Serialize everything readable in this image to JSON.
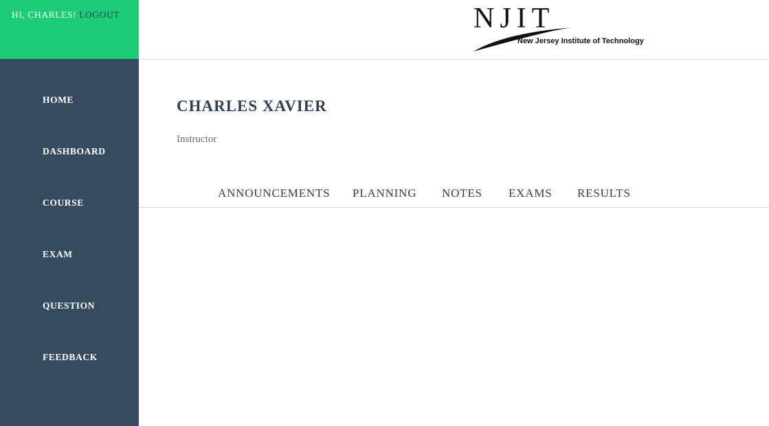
{
  "header": {
    "greeting": "HI, CHARLES!",
    "logout_label": "LOGOUT",
    "logo": {
      "wordmark": "NJIT",
      "tagline": "New Jersey Institute of Technology"
    }
  },
  "sidebar": {
    "items": [
      {
        "label": "HOME"
      },
      {
        "label": "DASHBOARD"
      },
      {
        "label": "COURSE"
      },
      {
        "label": "EXAM"
      },
      {
        "label": "QUESTION"
      },
      {
        "label": "FEEDBACK"
      }
    ]
  },
  "profile": {
    "name": "CHARLES XAVIER",
    "role": "Instructor"
  },
  "tabs": [
    {
      "label": "ANNOUNCEMENTS"
    },
    {
      "label": "PLANNING"
    },
    {
      "label": "NOTES"
    },
    {
      "label": "EXAMS"
    },
    {
      "label": "RESULTS"
    }
  ],
  "colors": {
    "sidebar_bg": "#374b60",
    "greeting_bg": "#1dcc77",
    "heading": "#2e3f56",
    "logout_link": "#2a3e5c"
  }
}
